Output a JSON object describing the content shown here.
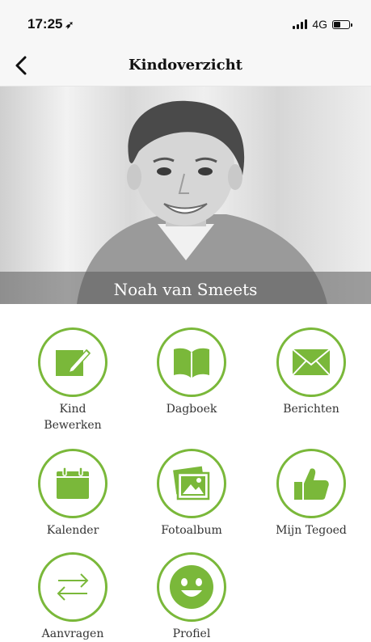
{
  "status": {
    "time": "17:25",
    "network": "4G"
  },
  "nav": {
    "title": "Kindoverzicht"
  },
  "hero": {
    "name": "Noah van Smeets"
  },
  "accent": "#7ab83a",
  "tiles": [
    {
      "label": "Kind\nBewerken",
      "icon": "edit-icon"
    },
    {
      "label": "Dagboek",
      "icon": "book-icon"
    },
    {
      "label": "Berichten",
      "icon": "envelope-icon"
    },
    {
      "label": "Kalender",
      "icon": "calendar-icon"
    },
    {
      "label": "Fotoalbum",
      "icon": "photo-album-icon"
    },
    {
      "label": "Mijn Tegoed",
      "icon": "thumbs-up-icon"
    },
    {
      "label": "Aanvragen",
      "icon": "exchange-arrows-icon"
    },
    {
      "label": "Profiel",
      "icon": "smiley-icon"
    }
  ]
}
